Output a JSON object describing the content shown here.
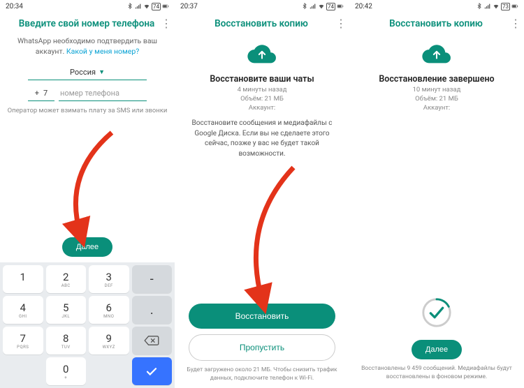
{
  "status": {
    "time1": "20:34",
    "time2": "20:37",
    "time3": "20:42",
    "battery1": "74",
    "battery2": "74",
    "battery3": "73"
  },
  "s1": {
    "title": "Введите свой номер телефона",
    "body_prefix": "WhatsApp необходимо подтвердить ваш аккаунт. ",
    "body_link": "Какой у меня номер?",
    "country": "Россия",
    "cc_plus": "+",
    "cc_num": "7",
    "phone_placeholder": "номер телефона",
    "disclaimer": "Оператор может взимать плату за SMS или звонки",
    "next": "Далее",
    "keys": {
      "k1": "1",
      "k2": "2",
      "k2s": "ABC",
      "k3": "3",
      "k3s": "DEF",
      "k4": "4",
      "k4s": "GHI",
      "k5": "5",
      "k5s": "JKL",
      "k6": "6",
      "k6s": "MNO",
      "k7": "7",
      "k7s": "PQRS",
      "k8": "8",
      "k8s": "TUV",
      "k9": "9",
      "k9s": "WXYZ",
      "k0": "0",
      "k0s": "+",
      "dash": "-",
      "dot": "."
    }
  },
  "s2": {
    "title": "Восстановить копию",
    "heading": "Восстановите ваши чаты",
    "time_ago": "4 минуты назад",
    "size": "Объём: 21 МБ",
    "account": "Аккаунт:",
    "desc": "Восстановите сообщения и медиафайлы с Google Диска. Если вы не сделаете этого сейчас, позже у вас не будет такой возможности.",
    "restore": "Восстановить",
    "skip": "Пропустить",
    "footer": "Будет загружено около 21 МБ. Чтобы снизить трафик данных, подключите телефон к Wi-Fi."
  },
  "s3": {
    "title": "Восстановить копию",
    "heading": "Восстановление завершено",
    "time_ago": "10 минут назад",
    "size": "Объём: 21 МБ",
    "account": "Аккаунт:",
    "next": "Далее",
    "footer": "Восстановлены 9 459 сообщений. Медиафайлы будут восстановлены в фоновом режиме."
  }
}
